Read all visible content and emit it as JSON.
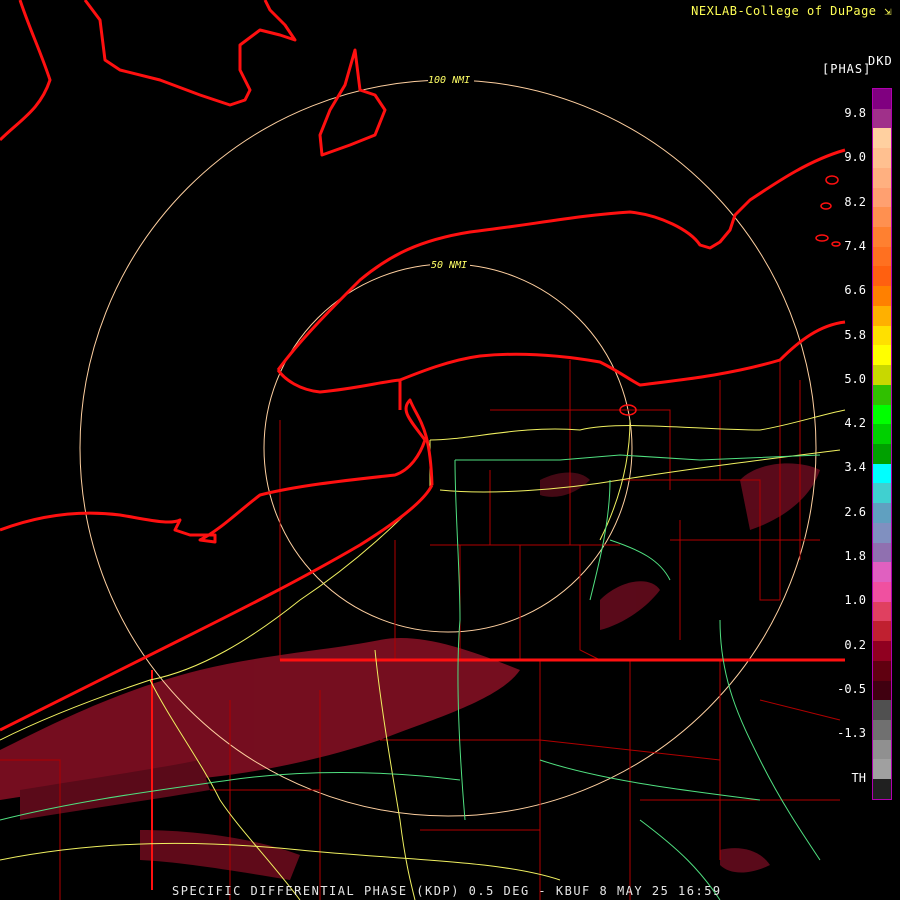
{
  "credit": "NEXLAB-College of DuPage",
  "credit_icon": "diagonal-arrow-icon",
  "footer": "SPECIFIC DIFFERENTIAL PHASE (KDP) 0.5 DEG - KBUF 8 MAY 25 16:59",
  "colorbar": {
    "unit_top": "DKD",
    "unit": "[PHAS]",
    "ticks": [
      "9.8",
      "9.0",
      "8.2",
      "7.4",
      "6.6",
      "5.8",
      "5.0",
      "4.2",
      "3.4",
      "2.6",
      "1.8",
      "1.0",
      "0.2",
      "-0.5",
      "-1.3",
      "TH"
    ],
    "colors": [
      "#800080",
      "#a0308a",
      "#ffd0a0",
      "#ffc090",
      "#ffb080",
      "#ffa070",
      "#ff9050",
      "#ff8030",
      "#ff7020",
      "#ff6010",
      "#ff8000",
      "#ffb000",
      "#ffe000",
      "#ffff00",
      "#c8d800",
      "#30c000",
      "#00ff00",
      "#00d000",
      "#00a000",
      "#00ffff",
      "#40d0d0",
      "#60a0c0",
      "#8090c0",
      "#9070b0",
      "#e060c0",
      "#f050a0",
      "#e04060",
      "#c02030",
      "#900020",
      "#600010",
      "#400010",
      "#505050",
      "#707070",
      "#909090",
      "#a0a0a0",
      "#202020"
    ]
  },
  "range_rings": [
    {
      "label": "50 NMI",
      "radius_nmi": 50
    },
    {
      "label": "100 NMI",
      "radius_nmi": 100
    }
  ],
  "colors": {
    "coast": "#ff1010",
    "county": "#c00000",
    "road_yellow": "#f0f060",
    "road_green": "#50e080",
    "ring": "#ffd0a0"
  }
}
